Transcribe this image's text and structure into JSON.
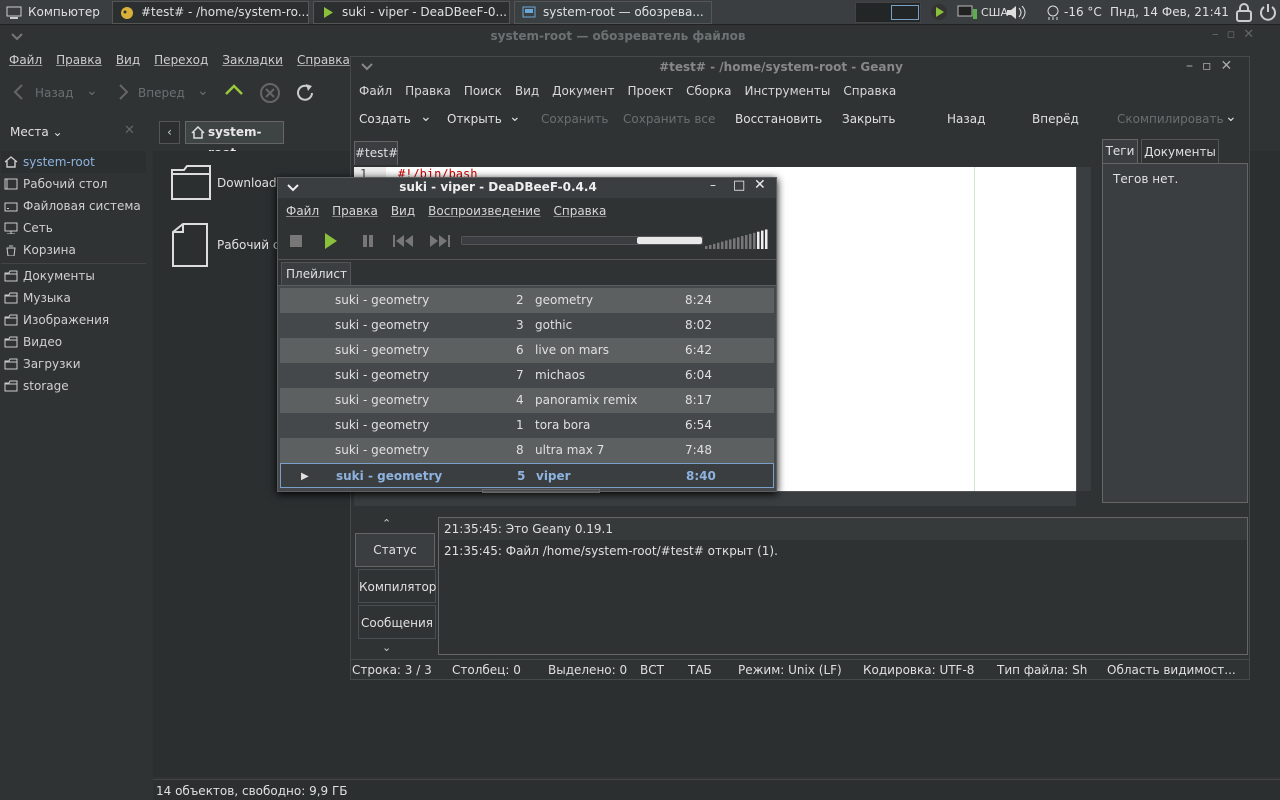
{
  "panel": {
    "computer": "Компьютер",
    "tasks": [
      "#test# - /home/system-ro...",
      "suki - viper - DeaDBeeF-0...",
      "system-root — обозрева..."
    ],
    "layout": "США",
    "weather": "-16 °C",
    "clock": "Пнд, 14 Фев, 21:41"
  },
  "fm": {
    "title": "system-root — обозреватель файлов",
    "menu": [
      "Файл",
      "Правка",
      "Вид",
      "Переход",
      "Закладки",
      "Справка"
    ],
    "back": "Назад",
    "forward": "Вперед",
    "places_label": "Места",
    "location": "system-root",
    "places": [
      {
        "label": "system-root",
        "icon": "home-icon"
      },
      {
        "label": "Рабочий стол",
        "icon": "desktop-icon"
      },
      {
        "label": "Файловая система",
        "icon": "drive-icon"
      },
      {
        "label": "Сеть",
        "icon": "network-icon"
      },
      {
        "label": "Корзина",
        "icon": "trash-icon"
      },
      {
        "label": "Документы",
        "icon": "folder-icon"
      },
      {
        "label": "Музыка",
        "icon": "folder-icon"
      },
      {
        "label": "Изображения",
        "icon": "folder-icon"
      },
      {
        "label": "Видео",
        "icon": "folder-icon"
      },
      {
        "label": "Загрузки",
        "icon": "folder-icon"
      },
      {
        "label": "storage",
        "icon": "folder-icon"
      }
    ],
    "files": [
      "Downloads",
      "Рабочий с"
    ],
    "status": "14 объектов, свободно: 9,9 ГБ"
  },
  "geany": {
    "title": "#test# - /home/system-root - Geany",
    "menu": [
      "Файл",
      "Правка",
      "Поиск",
      "Вид",
      "Документ",
      "Проект",
      "Сборка",
      "Инструменты",
      "Справка"
    ],
    "tb": {
      "new": "Создать",
      "open": "Открыть",
      "save": "Сохранить",
      "saveall": "Сохранить все",
      "revert": "Восстановить",
      "close": "Закрыть",
      "back": "Назад",
      "fwd": "Вперёд",
      "compile": "Скомпилировать"
    },
    "tab": "#test#",
    "line_no": "1",
    "code": "#!/bin/bash",
    "side_tabs": [
      "Теги",
      "Документы"
    ],
    "no_tags": "Тегов нет.",
    "msg_tabs": [
      "Статус",
      "Компилятор",
      "Сообщения"
    ],
    "msgs": [
      "21:35:45: Это Geany 0.19.1",
      "21:35:45: Файл /home/system-root/#test# открыт (1)."
    ],
    "status": {
      "line": "Строка: 3 / 3",
      "col": "Столбец: 0",
      "sel": "Выделено: 0",
      "ins": "ВСТ",
      "tab": "ТАБ",
      "mode": "Режим: Unix (LF)",
      "enc": "Кодировка: UTF-8",
      "ftype": "Тип файла: Sh",
      "scope": "Область видимост..."
    }
  },
  "ddb": {
    "title": "suki - viper - DeaDBeeF-0.4.4",
    "menu": [
      "Файл",
      "Правка",
      "Вид",
      "Воспроизведение",
      "Справка"
    ],
    "playlist_tab": "Плейлист",
    "progress": 0.73,
    "rows": [
      {
        "artist": "suki - geometry",
        "no": "2",
        "title": "geometry",
        "dur": "8:24"
      },
      {
        "artist": "suki - geometry",
        "no": "3",
        "title": "gothic",
        "dur": "8:02"
      },
      {
        "artist": "suki - geometry",
        "no": "6",
        "title": "live on mars",
        "dur": "6:42"
      },
      {
        "artist": "suki - geometry",
        "no": "7",
        "title": "michaos",
        "dur": "6:04"
      },
      {
        "artist": "suki - geometry",
        "no": "4",
        "title": "panoramix remix",
        "dur": "8:17"
      },
      {
        "artist": "suki - geometry",
        "no": "1",
        "title": "tora bora",
        "dur": "6:54"
      },
      {
        "artist": "suki - geometry",
        "no": "8",
        "title": "ultra max 7",
        "dur": "7:48"
      },
      {
        "artist": "suki - geometry",
        "no": "5",
        "title": "viper",
        "dur": "8:40"
      }
    ]
  }
}
